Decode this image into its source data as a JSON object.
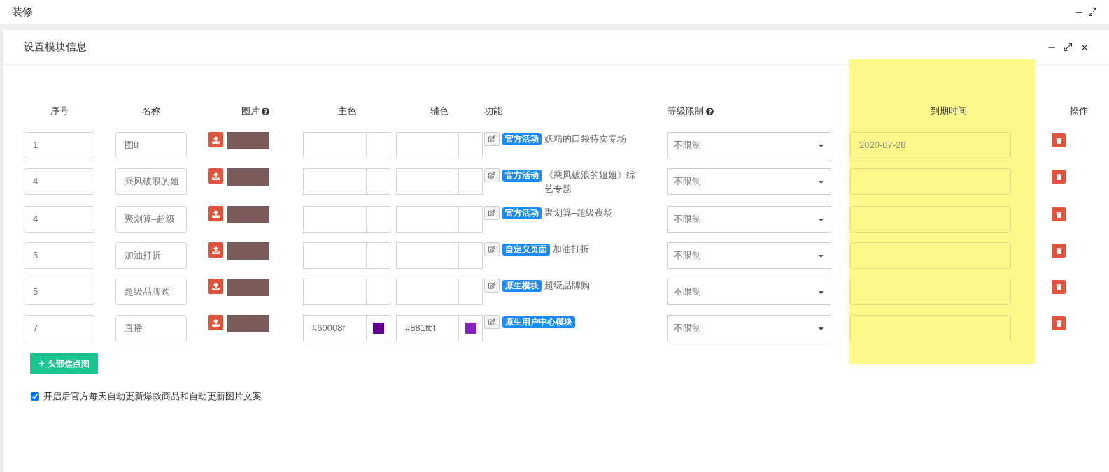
{
  "app": {
    "title": "装修"
  },
  "dialog": {
    "title": "设置模块信息"
  },
  "table": {
    "columns": [
      {
        "label": "序号",
        "help": false,
        "highlighted": false
      },
      {
        "label": "名称",
        "help": false,
        "highlighted": false
      },
      {
        "label": "图片",
        "help": true,
        "highlighted": false
      },
      {
        "label": "主色",
        "help": false,
        "highlighted": false
      },
      {
        "label": "辅色",
        "help": false,
        "highlighted": false
      },
      {
        "label": "功能",
        "help": false,
        "highlighted": false
      },
      {
        "label": "等级限制",
        "help": true,
        "highlighted": false
      },
      {
        "label": "到期时间",
        "help": false,
        "highlighted": true
      },
      {
        "label": "操作",
        "help": false,
        "highlighted": false
      }
    ],
    "rows": [
      {
        "index": "1",
        "name": "图8",
        "badge": "官方活动",
        "title": "妖精的口袋特卖专场",
        "grade": "不限制",
        "expiry": "2020-07-28"
      },
      {
        "index": "4",
        "name": "乘风破浪的姐",
        "badge": "官方活动",
        "title": "《乘风破浪的姐姐》综艺专题",
        "grade": "不限制"
      },
      {
        "index": "4",
        "name": "聚划算–超级",
        "badge": "官方活动",
        "title": "聚划算–超级夜场",
        "grade": "不限制"
      },
      {
        "index": "5",
        "name": "加油打折",
        "badge": "自定义页面",
        "title": "加油打折",
        "grade": "不限制"
      },
      {
        "index": "5",
        "name": "超级品牌购",
        "badge": "原生模块",
        "title": "超级品牌购",
        "grade": "不限制"
      },
      {
        "index": "7",
        "name": "直播",
        "main_color": {
          "value": "#60008f",
          "color": "#60008f"
        },
        "sub_color": {
          "value": "#881fbf",
          "color": "#881fbf"
        },
        "badge": "原生用户中心模块",
        "grade": "不限制"
      }
    ]
  },
  "add_button": "头部焦点图",
  "auto_update": {
    "label": "开启后官方每天自动更新爆款商品和自动更新图片文案",
    "checked": true
  }
}
